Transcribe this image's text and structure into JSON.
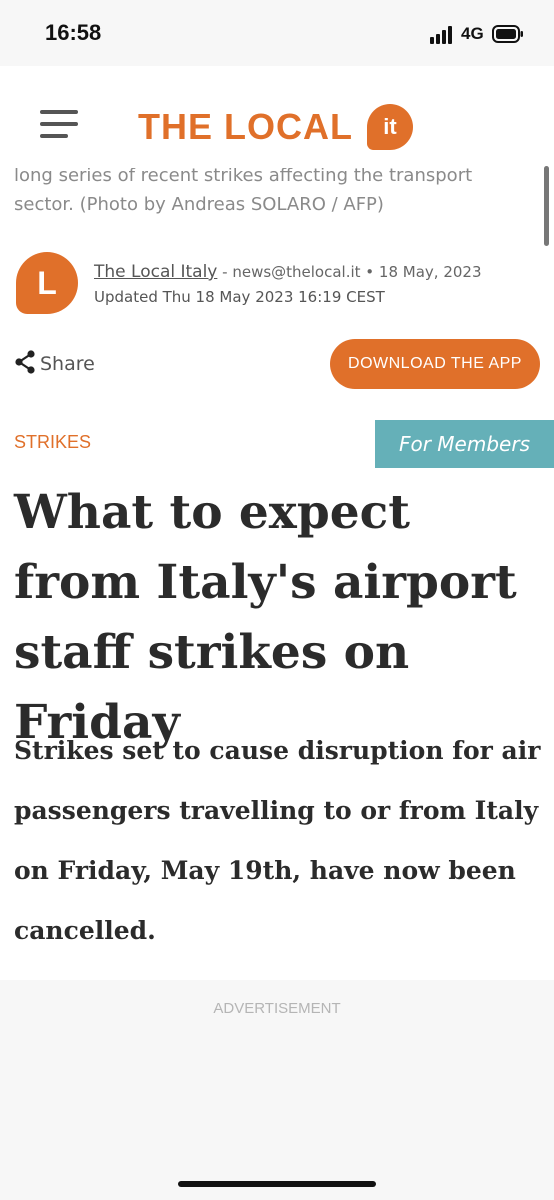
{
  "status_bar": {
    "time": "16:58",
    "network": "4G",
    "icons": [
      "signal-icon",
      "battery-icon"
    ]
  },
  "header": {
    "logo_text": "THE LOCAL",
    "logo_badge": "it",
    "icons": [
      "menu-icon"
    ]
  },
  "caption": {
    "line1": "long series of recent strikes affecting the transport",
    "line2": "sector. (Photo by Andreas SOLARO / AFP)"
  },
  "author": {
    "avatar_letter": "L",
    "name": "The Local Italy",
    "separator1": " - ",
    "email": "news@thelocal.it",
    "separator2": " • ",
    "date": "18 May, 2023",
    "updated": "Updated Thu 18 May 2023 16:19 CEST"
  },
  "actions": {
    "share_label": "Share",
    "download_label": "DOWNLOAD THE APP",
    "icons": [
      "share-icon"
    ]
  },
  "article": {
    "category": "STRIKES",
    "members_tag": "For Members",
    "headline": "What to expect from Italy's airport staff strikes on Friday",
    "standfirst": "Strikes set to cause disruption for air passengers travelling to or from Italy on Friday, May 19th, have now been cancelled."
  },
  "ad": {
    "label": "ADVERTISEMENT"
  },
  "colors": {
    "brand_orange": "#e0702a",
    "members_teal": "#65b0b8",
    "text_dark": "#2b2b2b",
    "caption_grey": "#8a8a8a"
  }
}
